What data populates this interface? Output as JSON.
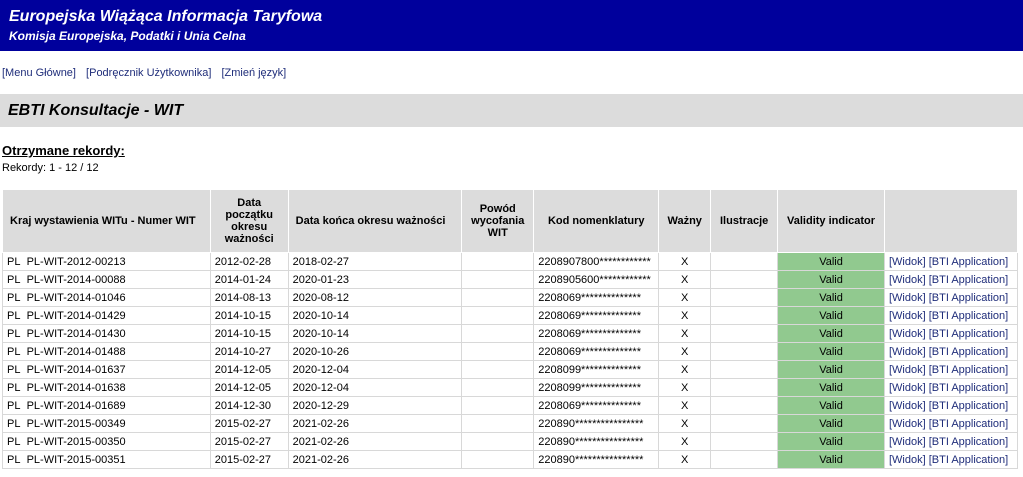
{
  "header": {
    "title": "Europejska Wiążąca Informacja Taryfowa",
    "subtitle": "Komisja Europejska, Podatki i Unia Celna"
  },
  "nav": {
    "menu": "[Menu Główne]",
    "manual": "[Podręcznik Użytkownika]",
    "language": "[Zmień język]"
  },
  "section_title": "EBTI Konsultacje - WIT",
  "records": {
    "title": "Otrzymane rekordy:",
    "count": "Rekordy: 1 - 12 / 12"
  },
  "table": {
    "headers": {
      "kraj": "Kraj wystawienia WITu - Numer WIT",
      "start": "Data początku okresu ważności",
      "end": "Data końca okresu ważności",
      "reason": "Powód wycofania WIT",
      "code": "Kod nomenklatury",
      "valid": "Ważny",
      "illus": "Ilustracje",
      "indicator": "Validity indicator"
    },
    "actions": {
      "view": "[Widok]",
      "app": "[BTI Application]"
    },
    "rows": [
      {
        "country": "PL",
        "number": "PL-WIT-2012-00213",
        "start": "2012-02-28",
        "end": "2018-02-27",
        "reason": "",
        "code": "2208907800************",
        "valid": "X",
        "illus": "",
        "indicator": "Valid"
      },
      {
        "country": "PL",
        "number": "PL-WIT-2014-00088",
        "start": "2014-01-24",
        "end": "2020-01-23",
        "reason": "",
        "code": "2208905600************",
        "valid": "X",
        "illus": "",
        "indicator": "Valid"
      },
      {
        "country": "PL",
        "number": "PL-WIT-2014-01046",
        "start": "2014-08-13",
        "end": "2020-08-12",
        "reason": "",
        "code": "2208069**************",
        "valid": "X",
        "illus": "",
        "indicator": "Valid"
      },
      {
        "country": "PL",
        "number": "PL-WIT-2014-01429",
        "start": "2014-10-15",
        "end": "2020-10-14",
        "reason": "",
        "code": "2208069**************",
        "valid": "X",
        "illus": "",
        "indicator": "Valid"
      },
      {
        "country": "PL",
        "number": "PL-WIT-2014-01430",
        "start": "2014-10-15",
        "end": "2020-10-14",
        "reason": "",
        "code": "2208069**************",
        "valid": "X",
        "illus": "",
        "indicator": "Valid"
      },
      {
        "country": "PL",
        "number": "PL-WIT-2014-01488",
        "start": "2014-10-27",
        "end": "2020-10-26",
        "reason": "",
        "code": "2208069**************",
        "valid": "X",
        "illus": "",
        "indicator": "Valid"
      },
      {
        "country": "PL",
        "number": "PL-WIT-2014-01637",
        "start": "2014-12-05",
        "end": "2020-12-04",
        "reason": "",
        "code": "2208099**************",
        "valid": "X",
        "illus": "",
        "indicator": "Valid"
      },
      {
        "country": "PL",
        "number": "PL-WIT-2014-01638",
        "start": "2014-12-05",
        "end": "2020-12-04",
        "reason": "",
        "code": "2208099**************",
        "valid": "X",
        "illus": "",
        "indicator": "Valid"
      },
      {
        "country": "PL",
        "number": "PL-WIT-2014-01689",
        "start": "2014-12-30",
        "end": "2020-12-29",
        "reason": "",
        "code": "2208069**************",
        "valid": "X",
        "illus": "",
        "indicator": "Valid"
      },
      {
        "country": "PL",
        "number": "PL-WIT-2015-00349",
        "start": "2015-02-27",
        "end": "2021-02-26",
        "reason": "",
        "code": "220890****************",
        "valid": "X",
        "illus": "",
        "indicator": "Valid"
      },
      {
        "country": "PL",
        "number": "PL-WIT-2015-00350",
        "start": "2015-02-27",
        "end": "2021-02-26",
        "reason": "",
        "code": "220890****************",
        "valid": "X",
        "illus": "",
        "indicator": "Valid"
      },
      {
        "country": "PL",
        "number": "PL-WIT-2015-00351",
        "start": "2015-02-27",
        "end": "2021-02-26",
        "reason": "",
        "code": "220890****************",
        "valid": "X",
        "illus": "",
        "indicator": "Valid"
      }
    ]
  },
  "colors": {
    "banner": "#00009c",
    "header_bg": "#dcdcdc",
    "valid_bg": "#91c98f",
    "link": "#1f2d7a"
  }
}
